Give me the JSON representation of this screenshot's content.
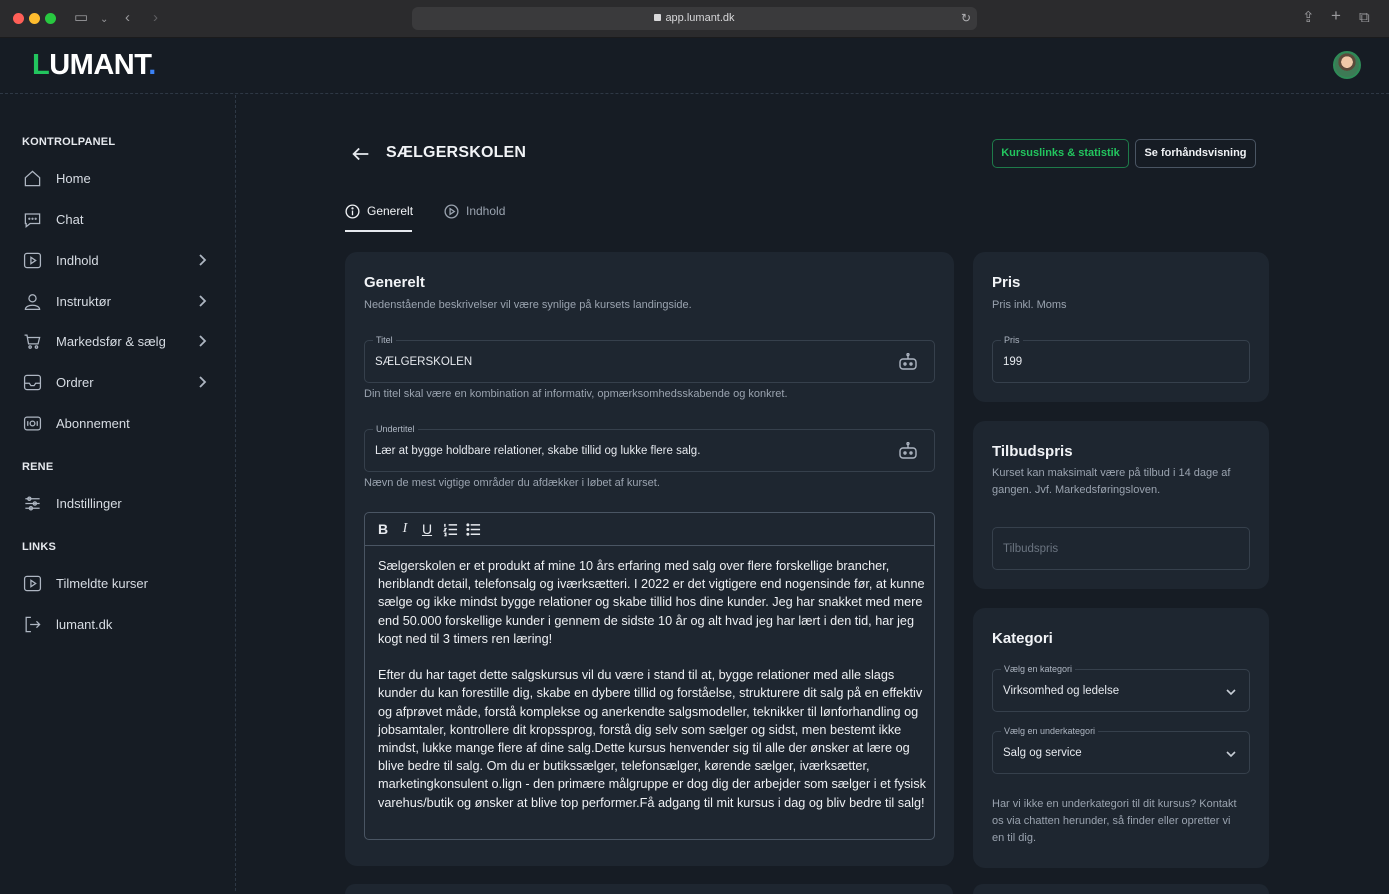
{
  "browser": {
    "url": "app.lumant.dk"
  },
  "header": {
    "logo_main": "UMANT",
    "logo_first": "L",
    "logo_dot": "."
  },
  "sidebar": {
    "sections": [
      "KONTROLPANEL",
      "RENE",
      "LINKS"
    ],
    "items": [
      {
        "label": "Home",
        "icon": "home-icon"
      },
      {
        "label": "Chat",
        "icon": "chat-icon"
      },
      {
        "label": "Indhold",
        "icon": "play-icon",
        "expandable": true
      },
      {
        "label": "Instruktør",
        "icon": "user-icon",
        "expandable": true
      },
      {
        "label": "Markedsfør & sælg",
        "icon": "cart-icon",
        "expandable": true
      },
      {
        "label": "Ordrer",
        "icon": "inbox-icon",
        "expandable": true
      },
      {
        "label": "Abonnement",
        "icon": "card-icon"
      },
      {
        "label": "Indstillinger",
        "icon": "sliders-icon"
      },
      {
        "label": "Tilmeldte kurser",
        "icon": "play-icon"
      },
      {
        "label": "lumant.dk",
        "icon": "external-link-icon"
      }
    ]
  },
  "page": {
    "title": "SÆLGERSKOLEN",
    "buttons": {
      "links_stats": "Kursuslinks & statistik",
      "preview": "Se forhåndsvisning"
    },
    "tabs": [
      {
        "label": "Generelt",
        "active": true,
        "icon": "info-icon"
      },
      {
        "label": "Indhold",
        "active": false,
        "icon": "play-circle-icon"
      }
    ]
  },
  "general": {
    "title": "Generelt",
    "subtitle": "Nedenstående beskrivelser vil være synlige på kursets landingside.",
    "title_field": {
      "label": "Titel",
      "value": "SÆLGERSKOLEN",
      "hint": "Din titel skal være en kombination af informativ, opmærksomhedsskabende og konkret."
    },
    "subtitle_field": {
      "label": "Undertitel",
      "value": "Lær at bygge holdbare relationer, skabe tillid og lukke flere salg.",
      "hint": "Nævn de mest vigtige områder du afdækker i løbet af kurset."
    },
    "editor": {
      "paragraphs": [
        "Sælgerskolen er et produkt af mine 10 års erfaring med salg over flere forskellige brancher, heriblandt detail, telefonsalg og iværksætteri. I 2022 er det vigtigere end nogensinde før, at kunne sælge og ikke mindst bygge relationer og skabe tillid hos dine kunder. Jeg har snakket med mere end 50.000 forskellige kunder i gennem de sidste 10 år og alt hvad jeg har lært i den tid, har jeg kogt ned til 3 timers ren læring!",
        "Efter du har taget dette salgskursus vil du være i stand til at, bygge relationer med alle slags kunder du kan forestille dig, skabe en dybere tillid og forståelse, strukturere dit salg på en effektiv og afprøvet måde, forstå komplekse og anerkendte salgsmodeller, teknikker til lønforhandling og jobsamtaler, kontrollere dit kropssprog, forstå dig selv som sælger og sidst, men bestemt ikke mindst, lukke mange flere af dine salg.Dette kursus henvender sig til alle der ønsker at lære og blive bedre til salg. Om du er butikssælger, telefonsælger, kørende sælger, iværksætter, marketingkonsulent o.lign - den primære målgruppe er dog dig der arbejder som sælger i et fysisk varehus/butik og ønsker at blive top performer.Få adgang til mit kursus i dag og bliv bedre til salg!"
      ]
    }
  },
  "price": {
    "title": "Pris",
    "subtitle": "Pris inkl. Moms",
    "label": "Pris",
    "value": "199"
  },
  "offer": {
    "title": "Tilbudspris",
    "subtitle": "Kurset kan maksimalt være på tilbud i 14 dage af gangen. Jvf. Markedsføringsloven.",
    "placeholder": "Tilbudspris"
  },
  "category": {
    "title": "Kategori",
    "cat_label": "Vælg en kategori",
    "cat_value": "Virksomhed og ledelse",
    "sub_label": "Vælg en underkategori",
    "sub_value": "Salg og service",
    "note": "Har vi ikke en underkategori til dit kursus? Kontakt os via chatten herunder, så finder eller opretter vi en til dig."
  },
  "colors": {
    "accent_green": "#22c55e",
    "logo_dot_blue": "#3b82f6",
    "background": "#161c24",
    "card": "#1e2630"
  }
}
